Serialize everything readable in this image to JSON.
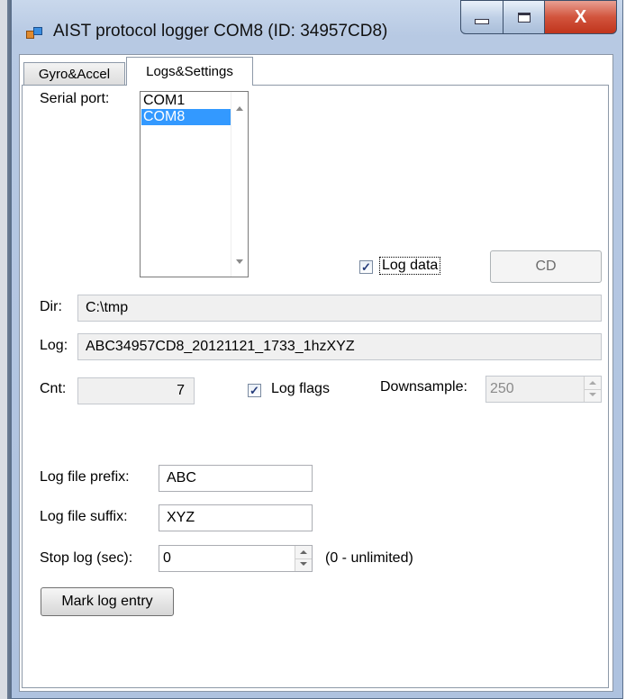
{
  "window": {
    "title": "AIST protocol logger COM8 (ID: 34957CD8)",
    "close_glyph": "X"
  },
  "tabs": [
    {
      "label": "Gyro&Accel",
      "active": false
    },
    {
      "label": "Logs&Settings",
      "active": true
    }
  ],
  "serial": {
    "label": "Serial port:",
    "ports": [
      "COM1",
      "COM8"
    ],
    "selected": "COM8"
  },
  "log_data": {
    "label": "Log data",
    "checked": true
  },
  "cd_button": {
    "label": "CD",
    "enabled": false
  },
  "dir": {
    "label": "Dir:",
    "value": "C:\\tmp"
  },
  "log": {
    "label": "Log:",
    "value": "ABC34957CD8_20121121_1733_1hzXYZ"
  },
  "cnt": {
    "label": "Cnt:",
    "value": "7"
  },
  "log_flags": {
    "label": "Log flags",
    "checked": true
  },
  "downsample": {
    "label": "Downsample:",
    "value": "250",
    "enabled": false
  },
  "prefix": {
    "label": "Log file prefix:",
    "value": "ABC"
  },
  "suffix": {
    "label": "Log file suffix:",
    "value": "XYZ"
  },
  "stop_log": {
    "label": "Stop log (sec):",
    "value": "0",
    "hint": "(0 - unlimited)"
  },
  "mark_button": {
    "label": "Mark log entry"
  },
  "colors": {
    "selection": "#3399ff",
    "close": "#c0341c",
    "frame": "#b7c9e3"
  }
}
